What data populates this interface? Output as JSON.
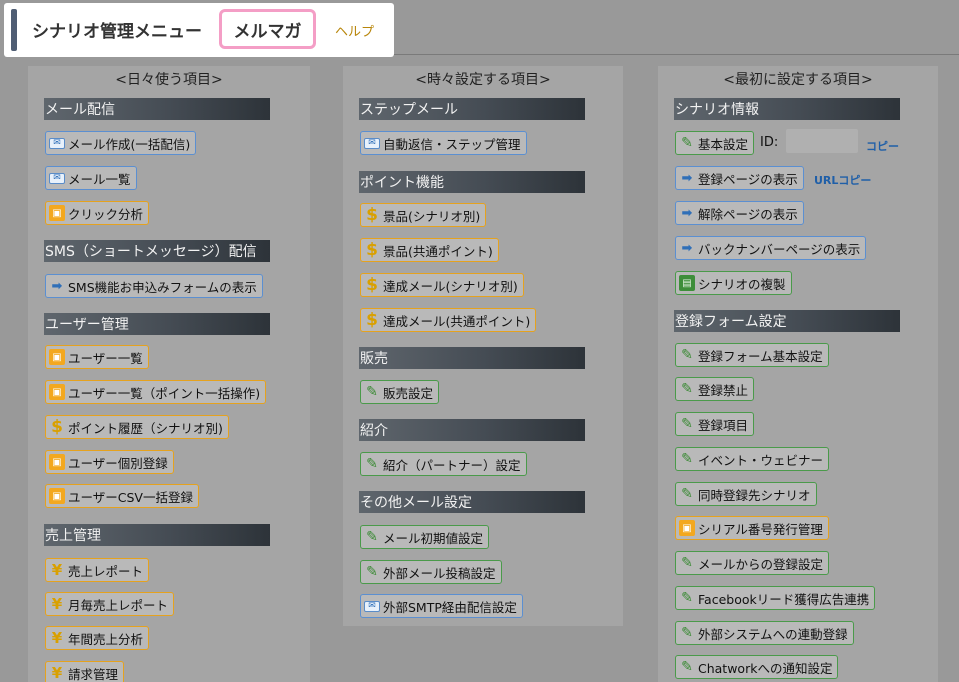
{
  "header": {
    "title": "シナリオ管理メニュー",
    "active_tab": "メルマガ",
    "help": "ヘルプ"
  },
  "columns": [
    {
      "title": "<日々使う項目>",
      "sections": [
        {
          "label": "メール配信",
          "items": [
            {
              "icon": "mail-icon",
              "label": "メール作成(一括配信)"
            },
            {
              "icon": "mail-icon",
              "label": "メール一覧"
            },
            {
              "icon": "click-icon",
              "label": "クリック分析"
            }
          ]
        },
        {
          "label": "SMS（ショートメッセージ）配信",
          "items": [
            {
              "icon": "arrow-icon",
              "label": "SMS機能お申込みフォームの表示"
            }
          ]
        },
        {
          "label": "ユーザー管理",
          "items": [
            {
              "icon": "click-icon",
              "label": "ユーザー一覧"
            },
            {
              "icon": "click-icon",
              "label": "ユーザー一覧（ポイント一括操作)"
            },
            {
              "icon": "dollar-icon",
              "label": "ポイント履歴（シナリオ別)"
            },
            {
              "icon": "click-icon",
              "label": "ユーザー個別登録"
            },
            {
              "icon": "click-icon",
              "label": "ユーザーCSV一括登録"
            }
          ]
        },
        {
          "label": "売上管理",
          "items": [
            {
              "icon": "yen-icon",
              "label": "売上レポート"
            },
            {
              "icon": "yen-icon",
              "label": "月毎売上レポート"
            },
            {
              "icon": "yen-icon",
              "label": "年間売上分析"
            },
            {
              "icon": "yen-icon",
              "label": "請求管理"
            }
          ]
        }
      ]
    },
    {
      "title": "<時々設定する項目>",
      "sections": [
        {
          "label": "ステップメール",
          "items": [
            {
              "icon": "mail-icon",
              "label": "自動返信・ステップ管理"
            }
          ]
        },
        {
          "label": "ポイント機能",
          "items": [
            {
              "icon": "dollar-icon",
              "label": "景品(シナリオ別)"
            },
            {
              "icon": "dollar-icon",
              "label": "景品(共通ポイント)"
            },
            {
              "icon": "dollar-icon",
              "label": "達成メール(シナリオ別)"
            },
            {
              "icon": "dollar-icon",
              "label": "達成メール(共通ポイント)"
            }
          ]
        },
        {
          "label": "販売",
          "items": [
            {
              "icon": "pen-icon",
              "label": "販売設定"
            }
          ]
        },
        {
          "label": "紹介",
          "items": [
            {
              "icon": "pen-icon",
              "label": "紹介（パートナー）設定"
            }
          ]
        },
        {
          "label": "その他メール設定",
          "items": [
            {
              "icon": "pen-icon",
              "label": "メール初期値設定"
            },
            {
              "icon": "pen-icon",
              "label": "外部メール投稿設定"
            },
            {
              "icon": "mail-icon",
              "label": "外部SMTP経由配信設定"
            }
          ]
        }
      ]
    },
    {
      "title": "<最初に設定する項目>",
      "sections": [
        {
          "label": "シナリオ情報",
          "items": [
            {
              "icon": "pen-icon",
              "label": "基本設定"
            },
            {
              "icon": "arrow-icon",
              "label": "登録ページの表示"
            },
            {
              "icon": "arrow-icon",
              "label": "解除ページの表示"
            },
            {
              "icon": "arrow-icon",
              "label": "バックナンバーページの表示"
            },
            {
              "icon": "copy-icon",
              "label": "シナリオの複製"
            }
          ]
        },
        {
          "label": "登録フォーム設定",
          "items": [
            {
              "icon": "pen-icon",
              "label": "登録フォーム基本設定"
            },
            {
              "icon": "pen-icon",
              "label": "登録禁止"
            },
            {
              "icon": "pen-icon",
              "label": "登録項目"
            },
            {
              "icon": "pen-icon",
              "label": "イベント・ウェビナー"
            },
            {
              "icon": "pen-icon",
              "label": "同時登録先シナリオ"
            },
            {
              "icon": "click-icon",
              "label": "シリアル番号発行管理"
            },
            {
              "icon": "pen-icon",
              "label": "メールからの登録設定"
            },
            {
              "icon": "pen-icon",
              "label": "Facebookリード獲得広告連携"
            },
            {
              "icon": "pen-icon",
              "label": "外部システムへの連動登録"
            },
            {
              "icon": "pen-icon",
              "label": "Chatworkへの通知設定"
            }
          ]
        }
      ],
      "id_label": "ID:",
      "copy_link": "コピー",
      "url_copy_link": "URLコピー"
    }
  ],
  "icons": {
    "mail-icon": "✉",
    "click-icon": "▣",
    "dollar-icon": "$",
    "yen-icon": "¥",
    "arrow-icon": "➡",
    "pen-icon": "✎",
    "copy-icon": "▤"
  },
  "colors": {
    "page_bg": "#999999",
    "section_bar": "#454c54",
    "blue_border": "#5b8fd1",
    "orange_border": "#e5a21e",
    "green_border": "#4a9a4a",
    "active_tab_border": "#f49ec6",
    "link": "#1f5fa8",
    "help_link": "#b8860b"
  }
}
